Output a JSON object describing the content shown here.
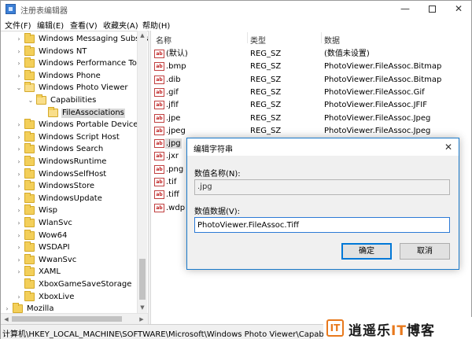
{
  "window": {
    "title": "注册表编辑器",
    "controls": {
      "minimize": "—",
      "maximize": "",
      "close": "✕"
    }
  },
  "menu": [
    "文件(F)",
    "编辑(E)",
    "查看(V)",
    "收藏夹(A)",
    "帮助(H)"
  ],
  "tree": {
    "items": [
      {
        "label": "Windows Messaging Subsys",
        "expander": "›",
        "selected": false
      },
      {
        "label": "Windows NT",
        "expander": "›",
        "selected": false
      },
      {
        "label": "Windows Performance Tool",
        "expander": "›",
        "selected": false
      },
      {
        "label": "Windows Phone",
        "expander": "›",
        "selected": false
      },
      {
        "label": "Windows Photo Viewer",
        "expander": "⌄",
        "selected": false
      },
      {
        "label": "Capabilities",
        "expander": "⌄",
        "selected": false
      },
      {
        "label": "FileAssociations",
        "expander": "",
        "selected": true
      },
      {
        "label": "Windows Portable Devices",
        "expander": "›",
        "selected": false
      },
      {
        "label": "Windows Script Host",
        "expander": "›",
        "selected": false
      },
      {
        "label": "Windows Search",
        "expander": "›",
        "selected": false
      },
      {
        "label": "WindowsRuntime",
        "expander": "›",
        "selected": false
      },
      {
        "label": "WindowsSelfHost",
        "expander": "›",
        "selected": false
      },
      {
        "label": "WindowsStore",
        "expander": "›",
        "selected": false
      },
      {
        "label": "WindowsUpdate",
        "expander": "›",
        "selected": false
      },
      {
        "label": "Wisp",
        "expander": "›",
        "selected": false
      },
      {
        "label": "WlanSvc",
        "expander": "›",
        "selected": false
      },
      {
        "label": "Wow64",
        "expander": "›",
        "selected": false
      },
      {
        "label": "WSDAPI",
        "expander": "›",
        "selected": false
      },
      {
        "label": "WwanSvc",
        "expander": "›",
        "selected": false
      },
      {
        "label": "XAML",
        "expander": "›",
        "selected": false
      },
      {
        "label": "XboxGameSaveStorage",
        "expander": "",
        "selected": false
      },
      {
        "label": "XboxLive",
        "expander": "›",
        "selected": false
      },
      {
        "label": "Mozilla",
        "expander": "›",
        "selected": false
      }
    ]
  },
  "list": {
    "columns": {
      "name": "名称",
      "type": "类型",
      "data": "数据"
    },
    "icon_text": "ab",
    "rows": [
      {
        "name": "(默认)",
        "type": "REG_SZ",
        "data": "(数值未设置)",
        "selected": false
      },
      {
        "name": ".bmp",
        "type": "REG_SZ",
        "data": "PhotoViewer.FileAssoc.Bitmap",
        "selected": false
      },
      {
        "name": ".dib",
        "type": "REG_SZ",
        "data": "PhotoViewer.FileAssoc.Bitmap",
        "selected": false
      },
      {
        "name": ".gif",
        "type": "REG_SZ",
        "data": "PhotoViewer.FileAssoc.Gif",
        "selected": false
      },
      {
        "name": ".jfif",
        "type": "REG_SZ",
        "data": "PhotoViewer.FileAssoc.JFIF",
        "selected": false
      },
      {
        "name": ".jpe",
        "type": "REG_SZ",
        "data": "PhotoViewer.FileAssoc.Jpeg",
        "selected": false
      },
      {
        "name": ".jpeg",
        "type": "REG_SZ",
        "data": "PhotoViewer.FileAssoc.Jpeg",
        "selected": false
      },
      {
        "name": ".jpg",
        "type": "",
        "data": "",
        "selected": true
      },
      {
        "name": ".jxr",
        "type": "",
        "data": "",
        "selected": false
      },
      {
        "name": ".png",
        "type": "",
        "data": "",
        "selected": false
      },
      {
        "name": ".tif",
        "type": "",
        "data": "",
        "selected": false
      },
      {
        "name": ".tiff",
        "type": "",
        "data": "",
        "selected": false
      },
      {
        "name": ".wdp",
        "type": "",
        "data": "",
        "selected": false
      }
    ]
  },
  "statusbar": {
    "path": "计算机\\HKEY_LOCAL_MACHINE\\SOFTWARE\\Microsoft\\Windows Photo Viewer\\Capabilities\\FileAssociations"
  },
  "dialog": {
    "title": "编辑字符串",
    "close": "✕",
    "name_label": "数值名称(N):",
    "name_value": ".jpg",
    "data_label": "数值数据(V):",
    "data_value": "PhotoViewer.FileAssoc.Tiff",
    "ok_label": "确定",
    "cancel_label": "取消"
  },
  "watermark": {
    "mark": "IT",
    "text_before": "逍遥乐",
    "text_it": "IT",
    "text_after": "博客"
  },
  "colors": {
    "accent": "#1979ca",
    "folder": "#f3cf5a",
    "selection": "#d9d9d9",
    "watermark_orange": "#e8791d"
  },
  "scroll_icons": {
    "up": "▲",
    "down": "▼",
    "left": "◀",
    "right": "▶"
  }
}
